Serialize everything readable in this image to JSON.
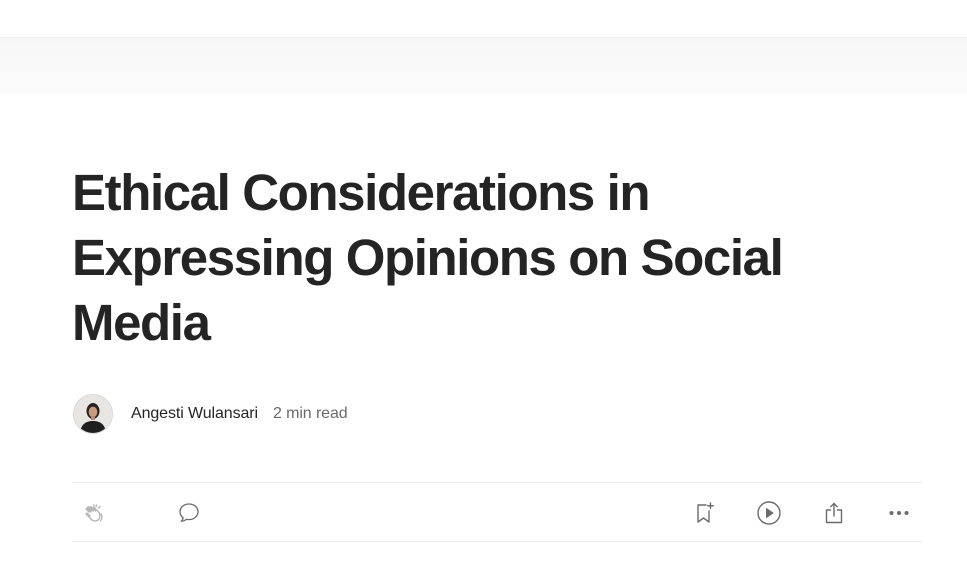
{
  "article": {
    "title": "Ethical Considerations in Expressing Opinions on Social Media",
    "author": "Angesti Wulansari",
    "read_time": "2 min read"
  },
  "actions": {
    "clap_icon": "clap-icon",
    "respond_icon": "speech-bubble-icon",
    "bookmark_icon": "bookmark-plus-icon",
    "listen_icon": "play-circle-icon",
    "share_icon": "share-icon",
    "more_icon": "more-horizontal-icon"
  },
  "colors": {
    "text": "#242424",
    "muted": "#6b6b6b",
    "icon": "#6b6b6b",
    "clap_icon": "#b3b3b3",
    "divider": "#efefef"
  }
}
